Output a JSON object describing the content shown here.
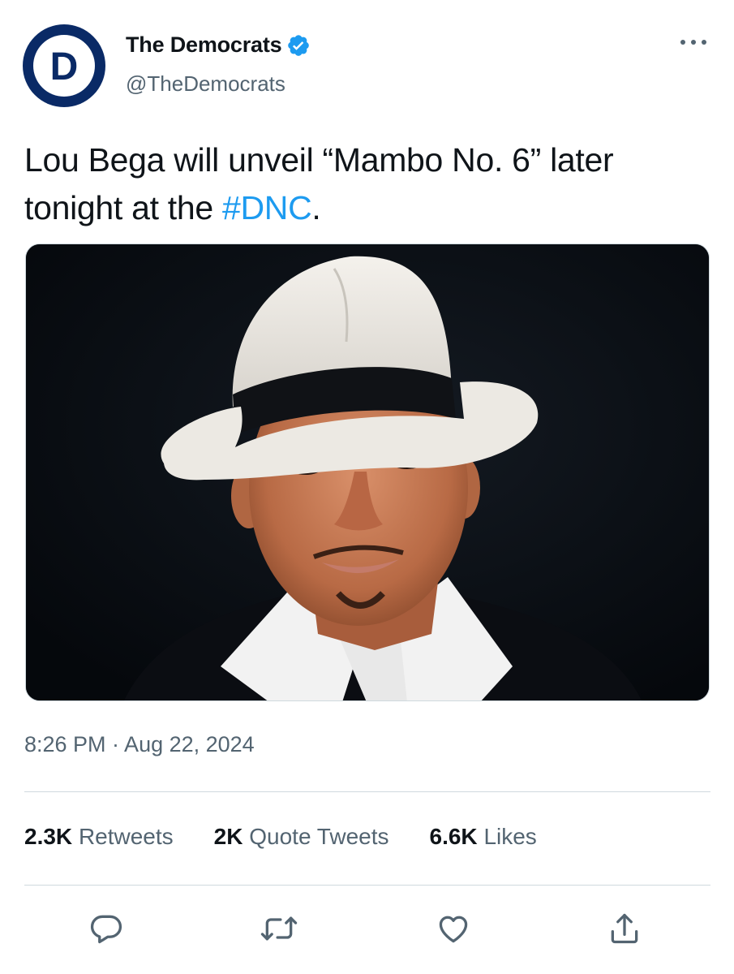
{
  "author": {
    "display_name": "The Democrats",
    "handle": "@TheDemocrats",
    "avatar_letter": "D",
    "avatar_color": "#0a2a66",
    "verified": true,
    "verified_color": "#1d9bf0"
  },
  "tweet": {
    "text_before": "Lou Bega will unveil “Mambo No. 6” later tonight at the ",
    "hashtag": "#DNC",
    "text_after": ".",
    "hashtag_color": "#1d9bf0",
    "timestamp": "8:26 PM · Aug 22, 2024"
  },
  "stats": {
    "retweets": {
      "count": "2.3K",
      "label": "Retweets"
    },
    "quote_tweets": {
      "count": "2K",
      "label": "Quote Tweets"
    },
    "likes": {
      "count": "6.6K",
      "label": "Likes"
    }
  },
  "actions": {
    "reply_icon": "reply-icon",
    "retweet_icon": "retweet-icon",
    "like_icon": "heart-icon",
    "share_icon": "share-icon"
  },
  "colors": {
    "text": "#0f1419",
    "secondary": "#536471",
    "divider": "#cfd9de"
  }
}
